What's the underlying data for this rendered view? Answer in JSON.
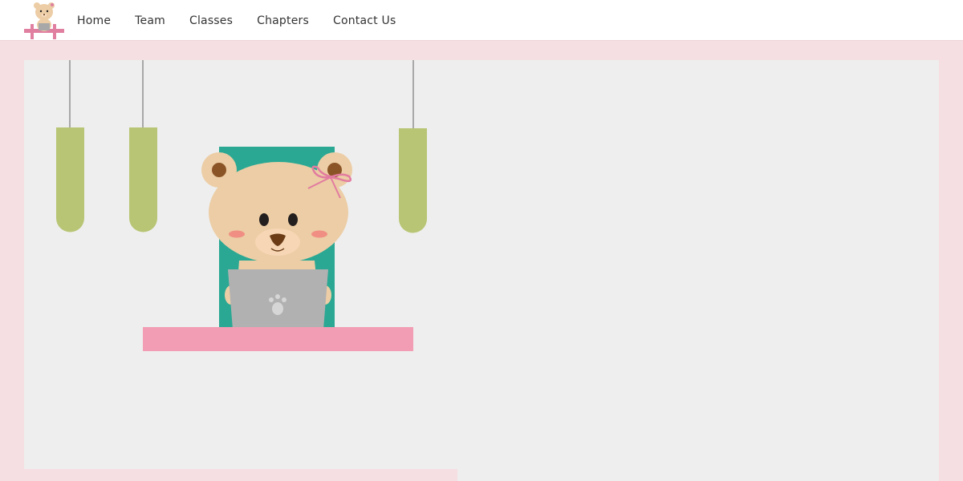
{
  "nav": {
    "items": [
      {
        "label": "Home"
      },
      {
        "label": "Team"
      },
      {
        "label": "Classes"
      },
      {
        "label": "Chapters"
      },
      {
        "label": "Contact Us"
      }
    ]
  },
  "colors": {
    "page_background": "#f5dfe2",
    "stage_background": "#eeeeee",
    "lamp_green": "#b8c574",
    "chair_teal": "#2aa893",
    "desk_pink": "#f29db3",
    "bear_fur": "#eccda5",
    "laptop_grey": "#b1b1b1"
  },
  "illustration": {
    "subject": "teddy-bear-with-laptop"
  }
}
